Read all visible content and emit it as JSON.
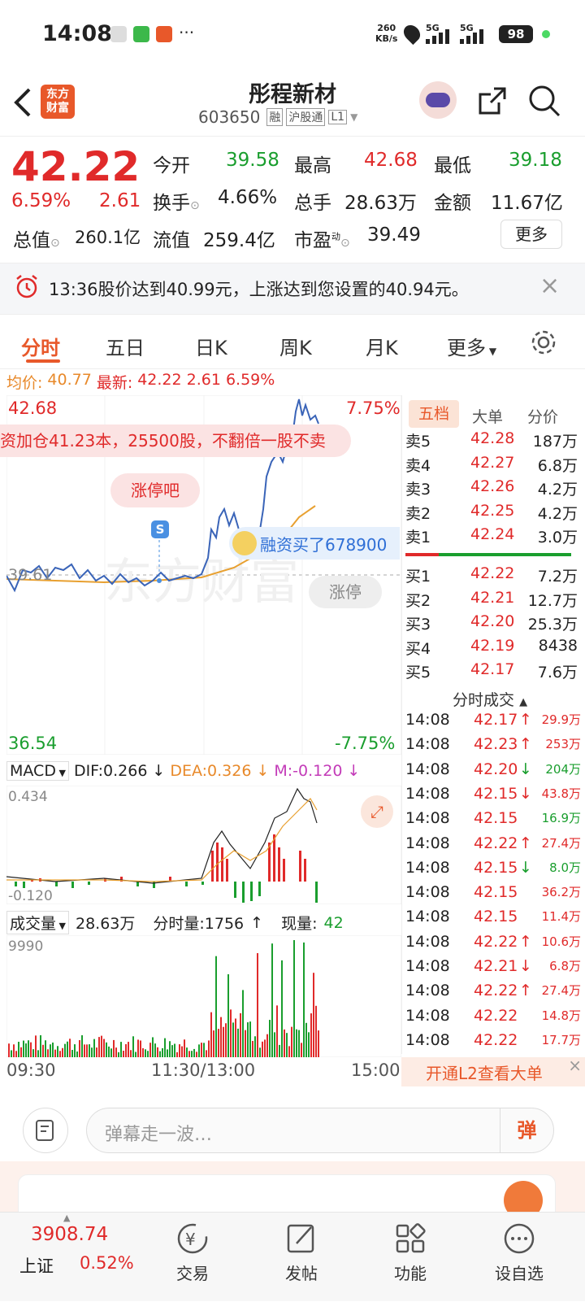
{
  "status_bar": {
    "time": "14:08",
    "net_speed": "260\nKB/s",
    "signal1": "5G",
    "signal2": "5G",
    "battery": "98"
  },
  "header": {
    "logo_text": "东方\n财富",
    "title": "彤程新材",
    "code": "603650",
    "tags": [
      "融",
      "沪股通",
      "L1"
    ]
  },
  "quote": {
    "price": "42.22",
    "change_pct": "6.59%",
    "change": "2.61",
    "open_label": "今开",
    "open": "39.58",
    "high_label": "最高",
    "high": "42.68",
    "low_label": "最低",
    "low": "39.18",
    "turnover_label": "换手",
    "turnover": "4.66%",
    "volume_label": "总手",
    "volume": "28.63万",
    "amount_label": "金额",
    "amount": "11.67亿",
    "mcap_label": "总值",
    "mcap": "260.1亿",
    "float_label": "流值",
    "float": "259.4亿",
    "pe_label": "市盈",
    "pe_sup": "动",
    "pe": "39.49",
    "more": "更多"
  },
  "alert": {
    "text": "13:36股价达到40.99元，上涨达到您设置的40.94元。"
  },
  "tabs": [
    "分时",
    "五日",
    "日K",
    "周K",
    "月K",
    "更多"
  ],
  "chart_info": {
    "avg_label": "均价:",
    "avg": "40.77",
    "latest_label": "最新:",
    "latest": "42.22",
    "chg": "2.61",
    "pct": "6.59%"
  },
  "chart": {
    "top_price": "42.68",
    "top_pct": "7.75%",
    "mid_price": "39.61",
    "bottom_price": "36.54",
    "bottom_pct": "-7.75%",
    "danmaku": "资加仓41.23本，25500股，不翻倍一股不卖",
    "bubble1": "涨停吧",
    "bubble2": "融资买了678900",
    "bubble3": "涨停",
    "marker": "S",
    "watermark": "东方财富"
  },
  "macd": {
    "label": "MACD",
    "dif": "DIF:0.266",
    "dea": "DEA:0.326",
    "m": "M:-0.120",
    "top": "0.434",
    "bottom": "-0.120"
  },
  "vol": {
    "label": "成交量",
    "total": "28.63万",
    "minute_vol": "分时量:1756",
    "cur_label": "现量:",
    "cur": "42",
    "top": "9990"
  },
  "time_axis": [
    "09:30",
    "11:30/13:00",
    "15:00"
  ],
  "order_book": {
    "tabs": [
      "五档",
      "大单",
      "分价"
    ],
    "sells": [
      {
        "l": "卖5",
        "p": "42.28",
        "v": "187万"
      },
      {
        "l": "卖4",
        "p": "42.27",
        "v": "6.8万"
      },
      {
        "l": "卖3",
        "p": "42.26",
        "v": "4.2万"
      },
      {
        "l": "卖2",
        "p": "42.25",
        "v": "4.2万"
      },
      {
        "l": "卖1",
        "p": "42.24",
        "v": "3.0万"
      }
    ],
    "buys": [
      {
        "l": "买1",
        "p": "42.22",
        "v": "7.2万"
      },
      {
        "l": "买2",
        "p": "42.21",
        "v": "12.7万"
      },
      {
        "l": "买3",
        "p": "42.20",
        "v": "25.3万"
      },
      {
        "l": "买4",
        "p": "42.19",
        "v": "8438"
      },
      {
        "l": "买5",
        "p": "42.17",
        "v": "7.6万"
      }
    ]
  },
  "trades_header": "分时成交",
  "trades": [
    {
      "t": "14:08",
      "p": "42.17",
      "a": "↑",
      "v": "29.9万",
      "c": "red"
    },
    {
      "t": "14:08",
      "p": "42.23",
      "a": "↑",
      "v": "253万",
      "c": "red"
    },
    {
      "t": "14:08",
      "p": "42.20",
      "a": "↓",
      "v": "204万",
      "c": "green"
    },
    {
      "t": "14:08",
      "p": "42.15",
      "a": "↓",
      "v": "43.8万",
      "c": "red"
    },
    {
      "t": "14:08",
      "p": "42.15",
      "a": "",
      "v": "16.9万",
      "c": "green"
    },
    {
      "t": "14:08",
      "p": "42.22",
      "a": "↑",
      "v": "27.4万",
      "c": "red"
    },
    {
      "t": "14:08",
      "p": "42.15",
      "a": "↓",
      "v": "8.0万",
      "c": "green"
    },
    {
      "t": "14:08",
      "p": "42.15",
      "a": "",
      "v": "36.2万",
      "c": "red"
    },
    {
      "t": "14:08",
      "p": "42.15",
      "a": "",
      "v": "11.4万",
      "c": "red"
    },
    {
      "t": "14:08",
      "p": "42.22",
      "a": "↑",
      "v": "10.6万",
      "c": "red"
    },
    {
      "t": "14:08",
      "p": "42.21",
      "a": "↓",
      "v": "6.8万",
      "c": "red"
    },
    {
      "t": "14:08",
      "p": "42.22",
      "a": "↑",
      "v": "27.4万",
      "c": "red"
    },
    {
      "t": "14:08",
      "p": "42.22",
      "a": "",
      "v": "14.8万",
      "c": "red"
    },
    {
      "t": "14:08",
      "p": "42.22",
      "a": "",
      "v": "17.7万",
      "c": "red"
    }
  ],
  "l2_banner": "开通L2查看大单",
  "comment": {
    "placeholder": "弹幕走一波…",
    "danmu_btn": "弹"
  },
  "bottom": {
    "index_value": "3908.74",
    "index_name": "上证",
    "index_pct": "0.52%",
    "items": [
      "交易",
      "发帖",
      "功能",
      "设自选"
    ]
  },
  "colors": {
    "up": "#e02a2a",
    "down": "#1a9e2e",
    "price_line": "#3a64b8",
    "avg_line": "#e8a030",
    "brand": "#e8582a"
  }
}
